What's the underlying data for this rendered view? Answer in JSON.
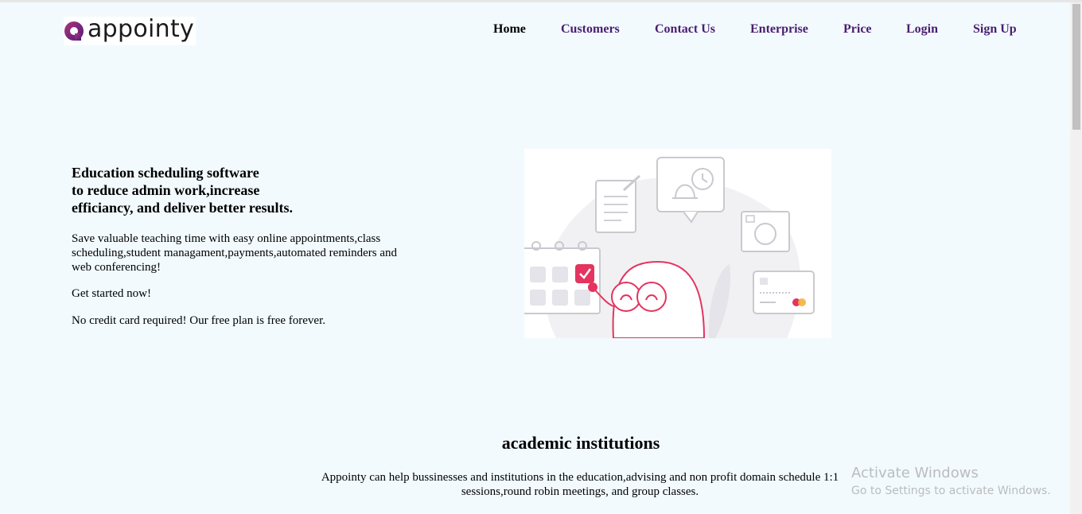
{
  "brand": {
    "name": "appointy",
    "logo_icon": "appointy-logo-icon",
    "accent": "#7b2a8f"
  },
  "nav": {
    "items": [
      {
        "label": "Home",
        "active": true
      },
      {
        "label": "Customers",
        "active": false
      },
      {
        "label": "Contact Us",
        "active": false
      },
      {
        "label": "Enterprise",
        "active": false
      },
      {
        "label": "Price",
        "active": false
      },
      {
        "label": "Login",
        "active": false
      },
      {
        "label": "Sign Up",
        "active": false
      }
    ],
    "color": "#4a1d70"
  },
  "hero": {
    "title_lines": [
      "Education scheduling software",
      "to reduce admin work,increase",
      "efficiancy, and deliver better results."
    ],
    "description": "Save valuable teaching time with easy online appointments,class scheduling,student managament,payments,automated reminders and web conferencing!",
    "cta": "Get started now!",
    "note": "No credit card required! Our free plan is free forever.",
    "illustration_icons": [
      "document-icon",
      "bell-clock-icon",
      "video-chat-icon",
      "calendar-icon",
      "credit-card-icon",
      "smiling-character-icon"
    ]
  },
  "section": {
    "title": "academic institutions",
    "description": "Appointy can help bussinesses and institutions in the education,advising and non profit domain schedule 1:1 sessions,round robin meetings, and group classes."
  },
  "watermark": {
    "title": "Activate Windows",
    "subtitle": "Go to Settings to activate Windows."
  }
}
